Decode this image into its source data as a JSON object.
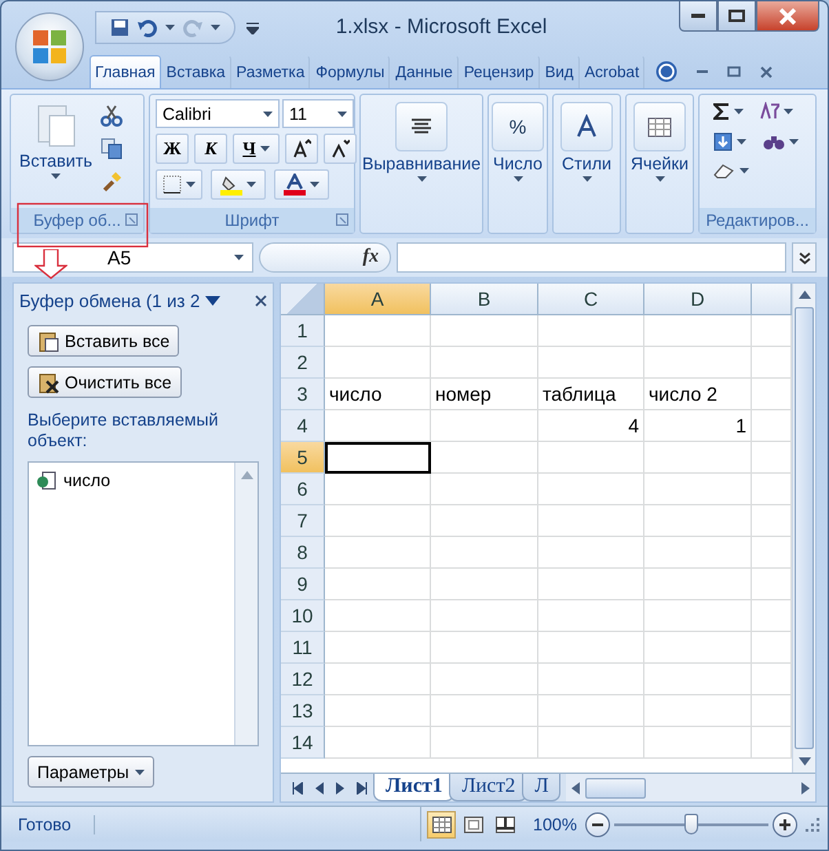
{
  "window": {
    "title": "1.xlsx - Microsoft Excel"
  },
  "ribbon_tabs": [
    {
      "label": "Главная",
      "selected": true
    },
    {
      "label": "Вставка",
      "selected": false
    },
    {
      "label": "Разметка",
      "selected": false
    },
    {
      "label": "Формулы",
      "selected": false
    },
    {
      "label": "Данные",
      "selected": false
    },
    {
      "label": "Рецензир",
      "selected": false
    },
    {
      "label": "Вид",
      "selected": false
    },
    {
      "label": "Acrobat",
      "selected": false
    }
  ],
  "ribbon": {
    "clipboard": {
      "paste_label": "Вставить",
      "title": "Буфер об..."
    },
    "font": {
      "font_name": "Calibri",
      "font_size": "11",
      "bold": "Ж",
      "italic": "К",
      "underline": "Ч",
      "title": "Шрифт"
    },
    "big_groups": [
      {
        "kind": "align",
        "label": "Выравнивание"
      },
      {
        "kind": "number",
        "label": "Число",
        "glyph": "%"
      },
      {
        "kind": "styles",
        "label": "Стили"
      },
      {
        "kind": "cells",
        "label": "Ячейки"
      }
    ],
    "editing": {
      "title": "Редактиров..."
    }
  },
  "formula_bar": {
    "name_box": "A5",
    "fx": "fx"
  },
  "task_pane": {
    "title": "Буфер обмена (1 из 2",
    "buttons": [
      {
        "kind": "paste",
        "label": "Вставить все"
      },
      {
        "kind": "clear",
        "label": "Очистить все"
      }
    ],
    "prompt": "Выберите вставляемый объект:",
    "items": [
      {
        "label": "число"
      }
    ],
    "options_button": "Параметры"
  },
  "sheet": {
    "columns": [
      {
        "label": "A",
        "selected": true
      },
      {
        "label": "B",
        "selected": false
      },
      {
        "label": "C",
        "selected": false
      },
      {
        "label": "D",
        "selected": false
      }
    ],
    "rows": [
      {
        "label": "1",
        "selected": false,
        "cells": {}
      },
      {
        "label": "2",
        "selected": false,
        "cells": {}
      },
      {
        "label": "3",
        "selected": false,
        "cells": {
          "a": {
            "text": "число"
          },
          "b": {
            "text": "номер"
          },
          "c": {
            "text": "таблица"
          },
          "d": {
            "text": "число 2"
          }
        }
      },
      {
        "label": "4",
        "selected": false,
        "cells": {
          "c": {
            "text": "4",
            "kind": "number"
          },
          "d": {
            "text": "1",
            "kind": "number"
          }
        }
      },
      {
        "label": "5",
        "selected": true,
        "cells": {}
      },
      {
        "label": "6",
        "selected": false,
        "cells": {}
      },
      {
        "label": "7",
        "selected": false,
        "cells": {}
      },
      {
        "label": "8",
        "selected": false,
        "cells": {}
      },
      {
        "label": "9",
        "selected": false,
        "cells": {}
      },
      {
        "label": "10",
        "selected": false,
        "cells": {}
      },
      {
        "label": "11",
        "selected": false,
        "cells": {}
      },
      {
        "label": "12",
        "selected": false,
        "cells": {}
      },
      {
        "label": "13",
        "selected": false,
        "cells": {}
      },
      {
        "label": "14",
        "selected": false,
        "cells": {}
      }
    ],
    "sheet_tabs": [
      {
        "label": "Лист1",
        "selected": true
      },
      {
        "label": "Лист2",
        "selected": false
      },
      {
        "label": "Л",
        "selected": false
      }
    ]
  },
  "status_bar": {
    "text": "Готово",
    "views": [
      {
        "kind": "normal",
        "selected": true
      },
      {
        "kind": "layout",
        "selected": false
      },
      {
        "kind": "pagebreak",
        "selected": false
      }
    ],
    "zoom": "100%",
    "zoom_slider": {
      "level": 0.5
    }
  }
}
